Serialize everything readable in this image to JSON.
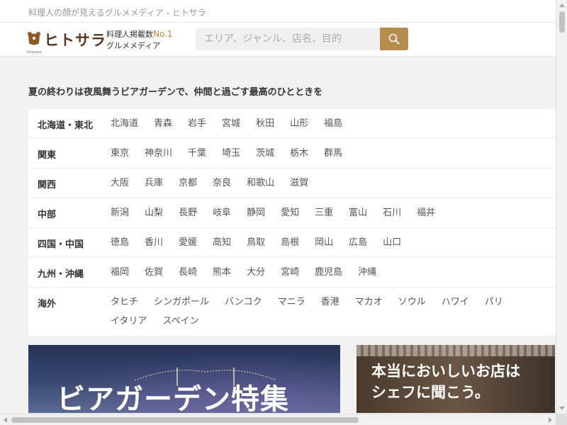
{
  "topbar": {
    "tagline": "料理人の顔が見えるグルメメディア - ヒトサラ"
  },
  "header": {
    "logo_text": "ヒトサラ",
    "logo_sub": "hitosara",
    "catch_line1_prefix": "料理人掲載数",
    "catch_line1_badge": "No.1",
    "catch_line2": "グルメメディア",
    "search_placeholder": "エリア、ジャンル、店名、目的",
    "search_icon": "search-icon"
  },
  "headline": "夏の終わりは夜風舞うビアガーデンで、仲間と過ごす最高のひとときを",
  "areas": [
    {
      "region": "北海道・東北",
      "prefs": [
        "北海道",
        "青森",
        "岩手",
        "宮城",
        "秋田",
        "山形",
        "福島"
      ]
    },
    {
      "region": "関東",
      "prefs": [
        "東京",
        "神奈川",
        "千葉",
        "埼玉",
        "茨城",
        "栃木",
        "群馬"
      ]
    },
    {
      "region": "関西",
      "prefs": [
        "大阪",
        "兵庫",
        "京都",
        "奈良",
        "和歌山",
        "滋賀"
      ]
    },
    {
      "region": "中部",
      "prefs": [
        "新潟",
        "山梨",
        "長野",
        "岐阜",
        "静岡",
        "愛知",
        "三重",
        "富山",
        "石川",
        "福井"
      ]
    },
    {
      "region": "四国・中国",
      "prefs": [
        "徳島",
        "香川",
        "愛媛",
        "高知",
        "鳥取",
        "島根",
        "岡山",
        "広島",
        "山口"
      ]
    },
    {
      "region": "九州・沖縄",
      "prefs": [
        "福岡",
        "佐賀",
        "長崎",
        "熊本",
        "大分",
        "宮崎",
        "鹿児島",
        "沖縄"
      ]
    },
    {
      "region": "海外",
      "prefs": [
        "タヒチ",
        "シンガポール",
        "バンコク",
        "マニラ",
        "香港",
        "マカオ",
        "ソウル",
        "ハワイ",
        "パリ",
        "イタリア",
        "スペイン"
      ]
    }
  ],
  "banners": {
    "left_title": "ビアガーデン特集",
    "right_line1": "本当においしいお店は",
    "right_line2": "シェフに聞こう。"
  },
  "colors": {
    "accent": "#b58c4b",
    "brand_brown": "#5a3a1e"
  }
}
